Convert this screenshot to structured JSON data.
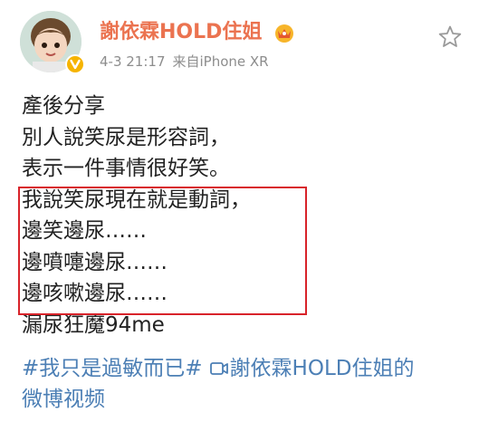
{
  "post": {
    "author": {
      "name": "謝依霖HOLD住姐",
      "avatar_icon": "child-avatar-icon",
      "verified_icon": "verified-v-icon",
      "badge_icon": "crown-badge-icon"
    },
    "meta": {
      "time": "4-3 21:17",
      "source": "来自iPhone XR"
    },
    "star_icon": "favorite-star-icon",
    "content_lines": [
      "產後分享",
      "別人說笑尿是形容詞，",
      "表示一件事情很好笑。",
      "我說笑尿現在就是動詞，",
      "邊笑邊尿……",
      "邊噴嚏邊尿……",
      "邊咳嗽邊尿……",
      "漏尿狂魔94me"
    ],
    "hashtag": "#我只是過敏而已#",
    "video_link_line1": "謝依霖HOLD住姐的",
    "video_link_line2": "微博视频",
    "colors": {
      "username": "#eb7350",
      "link": "#4c7fb5",
      "meta": "#8d8d8d",
      "highlight_border": "#d8232a"
    }
  }
}
